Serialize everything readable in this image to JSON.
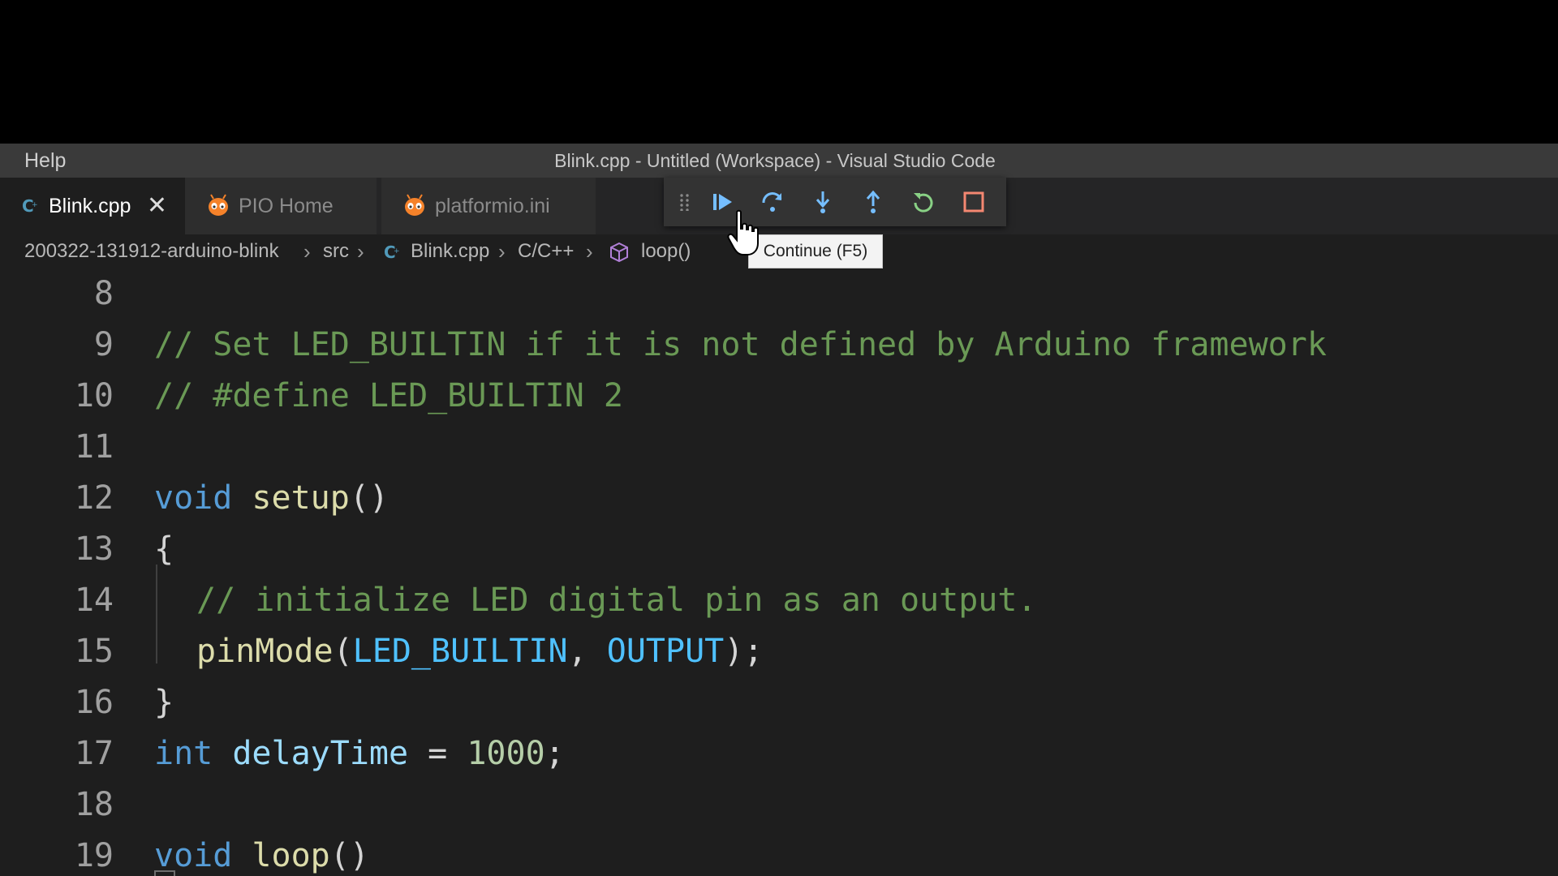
{
  "window": {
    "menu_help": "Help",
    "title": "Blink.cpp - Untitled (Workspace) - Visual Studio Code"
  },
  "tabs": [
    {
      "label": "Blink.cpp",
      "icon": "cpp-file-icon",
      "active": true,
      "close": "✕"
    },
    {
      "label": "PIO Home",
      "icon": "platformio-alien-icon",
      "active": false
    },
    {
      "label": "platformio.ini",
      "icon": "platformio-alien-icon",
      "active": false
    }
  ],
  "debug_toolbar": {
    "buttons": [
      "drag-handle",
      "continue",
      "step-over",
      "step-into",
      "step-out",
      "restart",
      "stop"
    ],
    "colors": {
      "blue": "#75beff",
      "green": "#89d185",
      "red": "#f48771"
    }
  },
  "tooltip": "Continue (F5)",
  "breadcrumbs": {
    "folder": "200322-131912-arduino-blink",
    "src": "src",
    "file": "Blink.cpp",
    "lang": "C/C++",
    "symbol": "loop()"
  },
  "editor": {
    "line_numbers": [
      "8",
      "9",
      "10",
      "11",
      "12",
      "13",
      "14",
      "15",
      "16",
      "17",
      "18",
      "19"
    ],
    "l9": "// Set LED_BUILTIN if it is not defined by Arduino framework",
    "l10": "// #define LED_BUILTIN 2",
    "l12_kw": "void",
    "l12_fn": " setup",
    "l12_rest": "()",
    "l13": "{",
    "l14": "// initialize LED digital pin as an output.",
    "l15_fn": "pinMode",
    "l15_p1": "(",
    "l15_c1": "LED_BUILTIN",
    "l15_p2": ", ",
    "l15_c2": "OUTPUT",
    "l15_p3": ");",
    "l16": "}",
    "l17_kw": "int",
    "l17_var": " delayTime",
    "l17_op": " = ",
    "l17_num": "1000",
    "l17_end": ";",
    "l19_kw": "void",
    "l19_fn": " loop",
    "l19_rest": "()"
  }
}
